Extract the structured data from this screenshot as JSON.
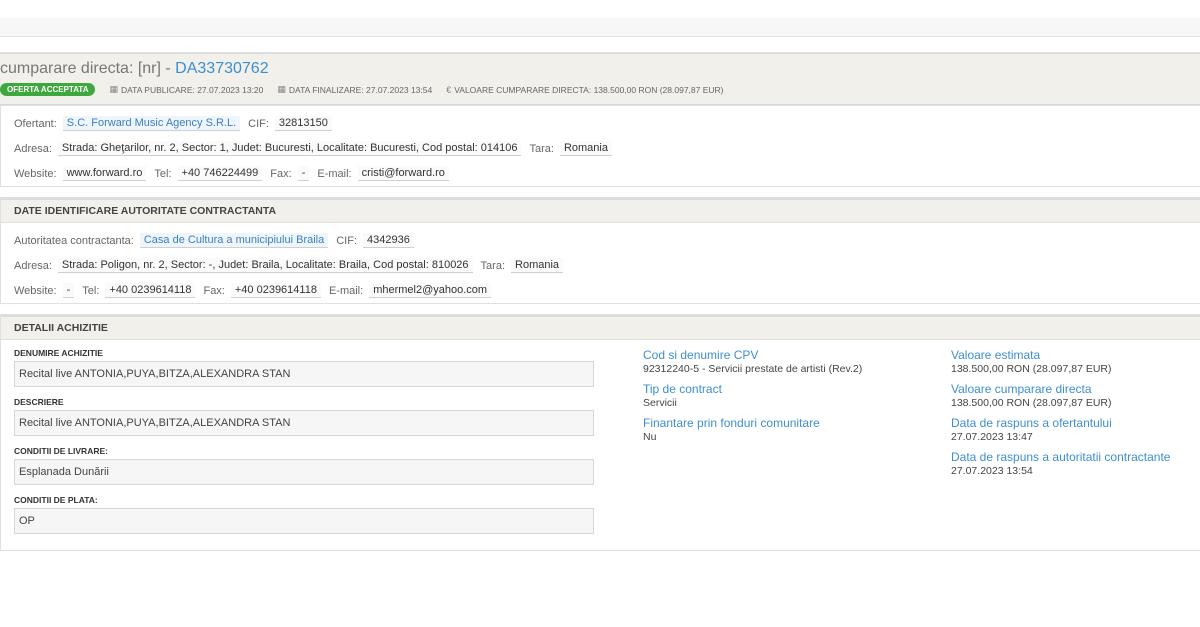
{
  "header": {
    "title_prefix": "cumparare directa: [nr] - ",
    "number": "DA33730762",
    "status_badge": "OFERTA ACCEPTATA",
    "publish_label": "DATA PUBLICARE: 27.07.2023 13:20",
    "final_label": "DATA FINALIZARE: 27.07.2023 13:54",
    "value_label": "VALOARE CUMPARARE DIRECTA: 138.500,00  RON (28.097,87  EUR)"
  },
  "ofertant": {
    "label": "Ofertant:",
    "name": "S.C. Forward Music Agency S.R.L.",
    "cif_label": "CIF:",
    "cif": "32813150",
    "address_label": "Adresa:",
    "address": "Strada: Gheţarilor, nr. 2, Sector: 1, Judet: Bucuresti, Localitate: Bucuresti, Cod postal: 014106",
    "country_label": "Tara:",
    "country": "Romania",
    "website_label": "Website:",
    "website": "www.forward.ro",
    "tel_label": "Tel:",
    "tel": "+40 746224499",
    "fax_label": "Fax:",
    "fax": "-",
    "email_label": "E-mail:",
    "email": "cristi@forward.ro"
  },
  "autoritate": {
    "section_title": "DATE IDENTIFICARE AUTORITATE CONTRACTANTA",
    "label": "Autoritatea contractanta:",
    "name": "Casa de Cultura a municipiului Braila",
    "cif_label": "CIF:",
    "cif": "4342936",
    "address_label": "Adresa:",
    "address": "Strada: Poligon, nr. 2, Sector: -, Judet: Braila, Localitate: Braila, Cod postal: 810026",
    "country_label": "Tara:",
    "country": "Romania",
    "website_label": "Website:",
    "website": "-",
    "tel_label": "Tel:",
    "tel": "+40 0239614118",
    "fax_label": "Fax:",
    "fax": "+40 0239614118",
    "email_label": "E-mail:",
    "email": "mhermel2@yahoo.com"
  },
  "detalii": {
    "section_title": "DETALII ACHIZITIE",
    "denumire_label": "DENUMIRE ACHIZITIE",
    "denumire": "Recital live ANTONIA,PUYA,BITZA,ALEXANDRA STAN",
    "descriere_label": "DESCRIERE",
    "descriere": "Recital live ANTONIA,PUYA,BITZA,ALEXANDRA STAN",
    "livrare_label": "CONDITII DE LIVRARE:",
    "livrare": "Esplanada Dunării",
    "plata_label": "CONDITII DE PLATA:",
    "plata": "OP",
    "cpv_label": "Cod si denumire CPV",
    "cpv": "92312240-5 - Servicii prestate de artisti (Rev.2)",
    "tip_label": "Tip de contract",
    "tip": "Servicii",
    "finantare_label": "Finantare prin fonduri comunitare",
    "finantare": "Nu",
    "estimata_label": "Valoare estimata",
    "estimata": "138.500,00  RON (28.097,87  EUR)",
    "cumparare_label": "Valoare cumparare directa",
    "cumparare": "138.500,00  RON (28.097,87  EUR)",
    "raspuns_ofertant_label": "Data de raspuns a ofertantului",
    "raspuns_ofertant": "27.07.2023 13:47",
    "raspuns_autoritate_label": "Data de raspuns a autoritatii contractante",
    "raspuns_autoritate": "27.07.2023 13:54"
  }
}
